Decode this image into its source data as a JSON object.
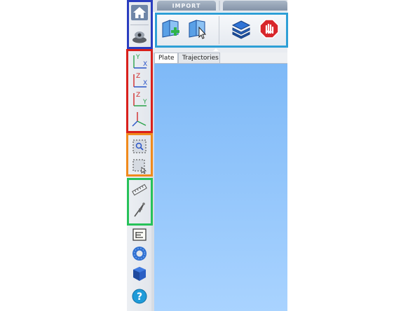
{
  "ribbon": {
    "tabs": [
      {
        "label": "IMPORT"
      },
      {
        "label": ""
      }
    ],
    "buttons": [
      {
        "icon": "add-view-icon"
      },
      {
        "icon": "select-view-icon"
      },
      {
        "icon": "layers-icon"
      },
      {
        "icon": "stop-hand-icon"
      }
    ]
  },
  "document_tabs": [
    {
      "label": "Plate"
    },
    {
      "label": "Trajectories"
    }
  ],
  "toolbar": {
    "groups": [
      {
        "color": "#2a3dbf",
        "icons": [
          "home-icon",
          "eye-icon"
        ]
      },
      {
        "color": "#d9201b",
        "icons": [
          "axis-yx-icon",
          "axis-zx-icon",
          "axis-zy-icon",
          "axis-3d-icon"
        ]
      },
      {
        "color": "#f08a1c",
        "icons": [
          "zoom-box-icon",
          "select-box-icon"
        ]
      },
      {
        "color": "#27c25a",
        "icons": [
          "ruler-icon",
          "compass-icon"
        ]
      },
      {
        "color": "#e2e6ec",
        "icons": [
          "list-icon",
          "torus-icon",
          "cube-icon",
          "help-icon"
        ]
      }
    ]
  },
  "colors": {
    "viewport_top": "#7eb9f7",
    "viewport_bottom": "#a9d3ff",
    "highlight_blue": "#2a3dbf",
    "highlight_red": "#d9201b",
    "highlight_orange": "#f08a1c",
    "highlight_green": "#27c25a",
    "highlight_cyan": "#2e9fd6"
  }
}
